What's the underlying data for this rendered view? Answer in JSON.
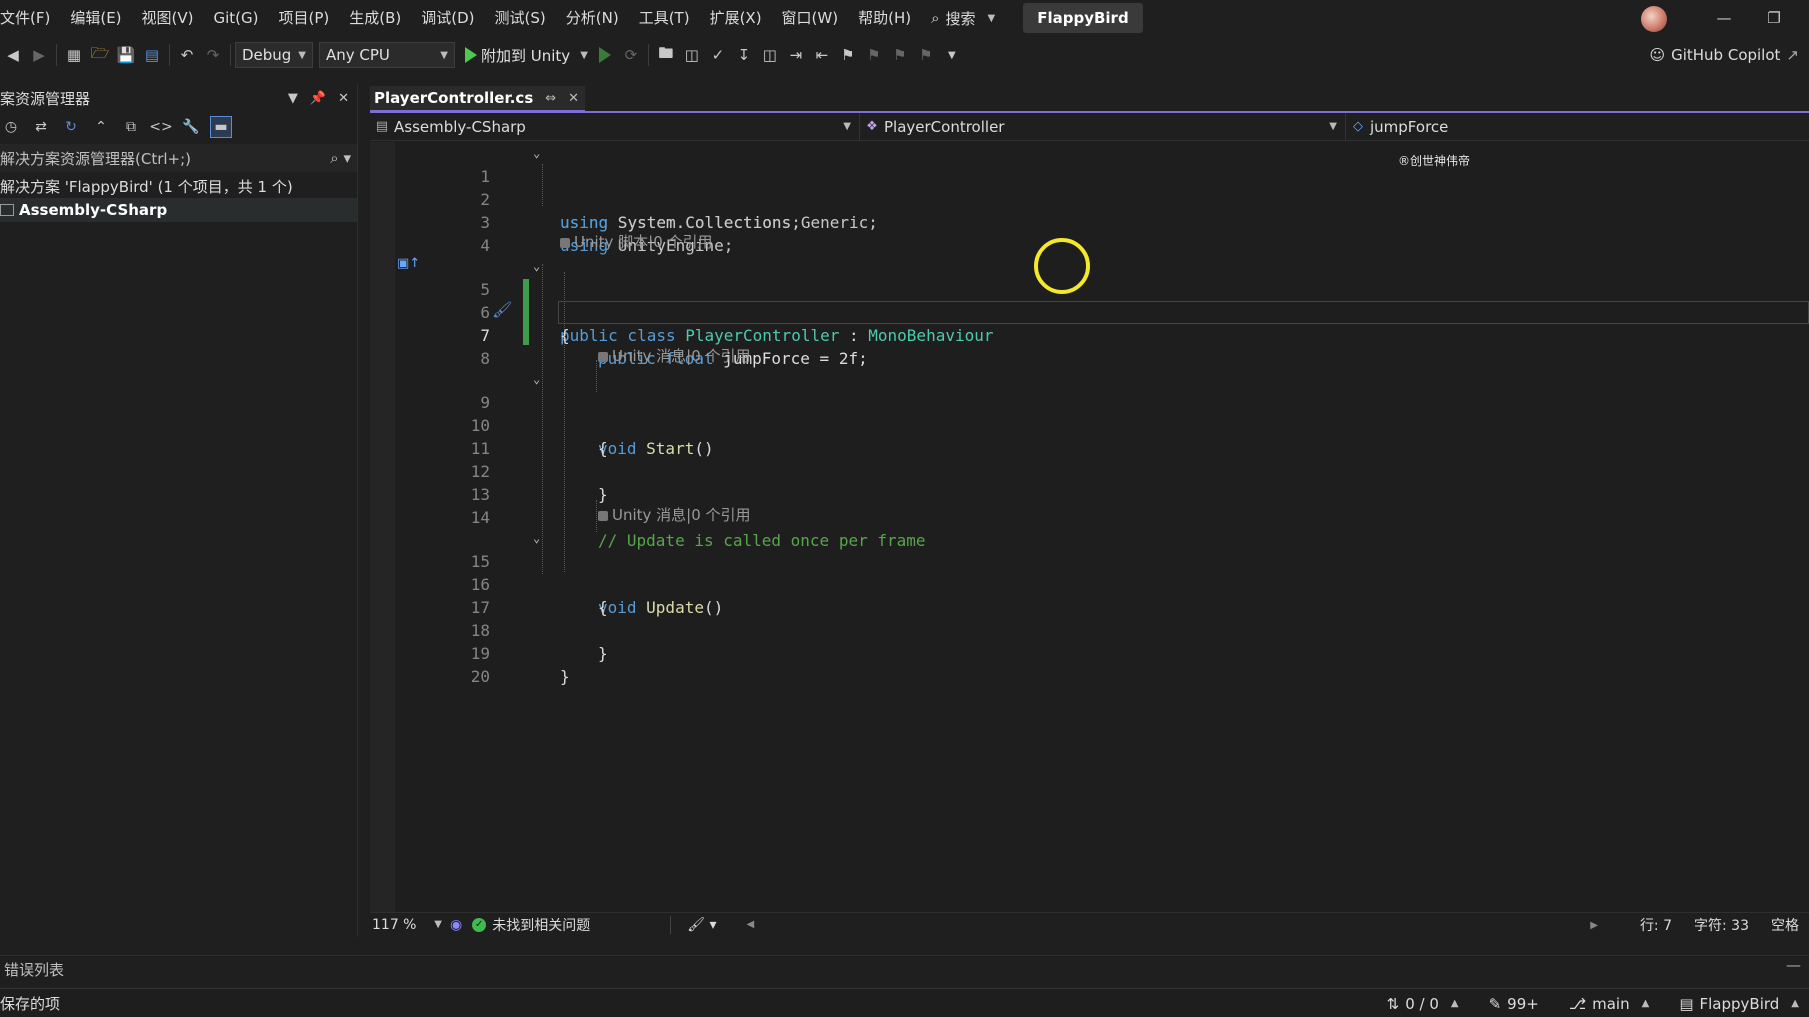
{
  "menu": [
    "文件(F)",
    "编辑(E)",
    "视图(V)",
    "Git(G)",
    "项目(P)",
    "生成(B)",
    "调试(D)",
    "测试(S)",
    "分析(N)",
    "工具(T)",
    "扩展(X)",
    "窗口(W)",
    "帮助(H)"
  ],
  "search_label": "搜索",
  "app_title": "FlappyBird",
  "toolbar": {
    "config": "Debug",
    "platform": "Any CPU",
    "run_label": "附加到 Unity",
    "copilot": "GitHub Copilot"
  },
  "solution_explorer": {
    "title": "案资源管理器",
    "search_placeholder": "解决方案资源管理器(Ctrl+;)",
    "solution": "解决方案 'FlappyBird' (1 个项目，共 1 个)",
    "project": "Assembly-CSharp"
  },
  "tab": {
    "label": "PlayerController.cs"
  },
  "nav": {
    "project": "Assembly-CSharp",
    "type": "PlayerController",
    "member": "jumpForce"
  },
  "watermark": "®创世神伟帝",
  "code": {
    "line1_kw": "using",
    "line1_rest": " System.Collections;",
    "line2_kw": "using",
    "line2_rest": " System.Collections.Generic;",
    "line3_kw": "using",
    "line3_rest": " UnityEngine;",
    "meta1": "Unity 脚本|0 个引用",
    "line5_kw": "public class",
    "line5_name": " PlayerController",
    "line5_colon": " : ",
    "line5_base": "MonoBehaviour",
    "line6": "{",
    "line7_kw": "public float",
    "line7_rest": " jumpForce = 2f;",
    "meta2": "Unity 消息|0 个引用",
    "line9_kw": "void",
    "line9_fn": " Start",
    "line9_rest": "()",
    "line10": "{",
    "line12": "}",
    "line14": "// Update is called once per frame",
    "meta3": "Unity 消息|0 个引用",
    "line15_kw": "void",
    "line15_fn": " Update",
    "line15_rest": "()",
    "line16": "{",
    "line18": "}",
    "line19": "}"
  },
  "line_numbers": [
    "1",
    "2",
    "3",
    "4",
    "5",
    "6",
    "7",
    "8",
    "9",
    "10",
    "11",
    "12",
    "13",
    "14",
    "15",
    "16",
    "17",
    "18",
    "19",
    "20"
  ],
  "editor_status": {
    "zoom": "117 %",
    "issues": "未找到相关问题",
    "line": "行: 7",
    "char": "字符: 33",
    "whitespace": "空格"
  },
  "bottom_panel": {
    "title": "错误列表"
  },
  "statusbar": {
    "left": "保存的项",
    "changes": "0 / 0",
    "edits": "99+",
    "branch": "main",
    "repo": "FlappyBird"
  },
  "colors": {
    "accent": "#7b6fd6",
    "keyword": "#569cd6",
    "type": "#4ec9b0",
    "comment": "#57a64a",
    "cursor_ring": "#f4e82c",
    "change_bar": "#3c9c4c"
  }
}
